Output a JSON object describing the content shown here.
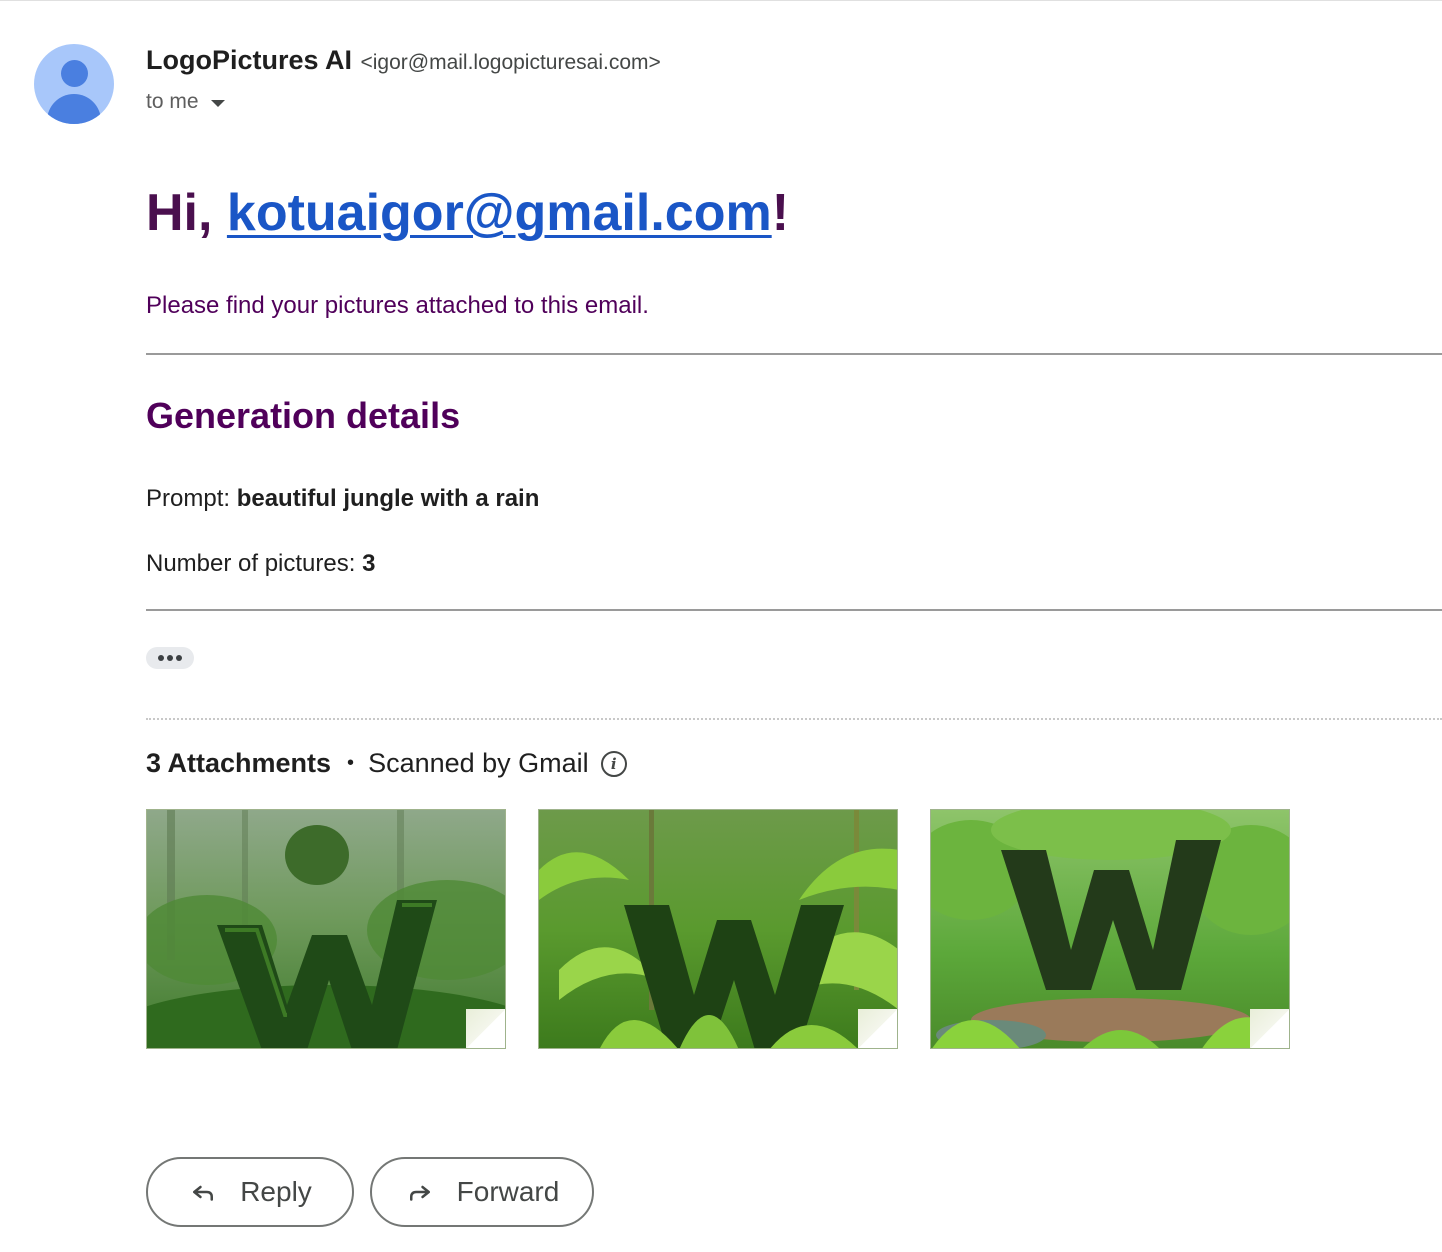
{
  "sender": {
    "name": "LogoPictures AI",
    "email": "<igor@mail.logopicturesai.com>",
    "recipients_label": "to me"
  },
  "body": {
    "greeting_prefix": "Hi, ",
    "greeting_email": "kotuaigor@gmail.com",
    "greeting_suffix": "!",
    "intro": "Please find your pictures attached to this email.",
    "section_title": "Generation details",
    "prompt_label": "Prompt: ",
    "prompt_value": "beautiful jungle with a rain",
    "count_label": "Number of pictures: ",
    "count_value": "3"
  },
  "attachments": {
    "count_label": "3 Attachments",
    "separator": "•",
    "scanned_label": "Scanned by Gmail",
    "items": [
      {
        "letter": "W",
        "theme": "rainy-jungle"
      },
      {
        "letter": "W",
        "theme": "palm-jungle"
      },
      {
        "letter": "W",
        "theme": "jungle-path"
      }
    ]
  },
  "actions": {
    "reply_label": "Reply",
    "forward_label": "Forward"
  },
  "colors": {
    "heading": "#4a0f4e",
    "link": "#1a56c6",
    "intro": "#50005a",
    "avatar_bg": "#a8c7fa",
    "avatar_fg": "#4a7fe0"
  }
}
